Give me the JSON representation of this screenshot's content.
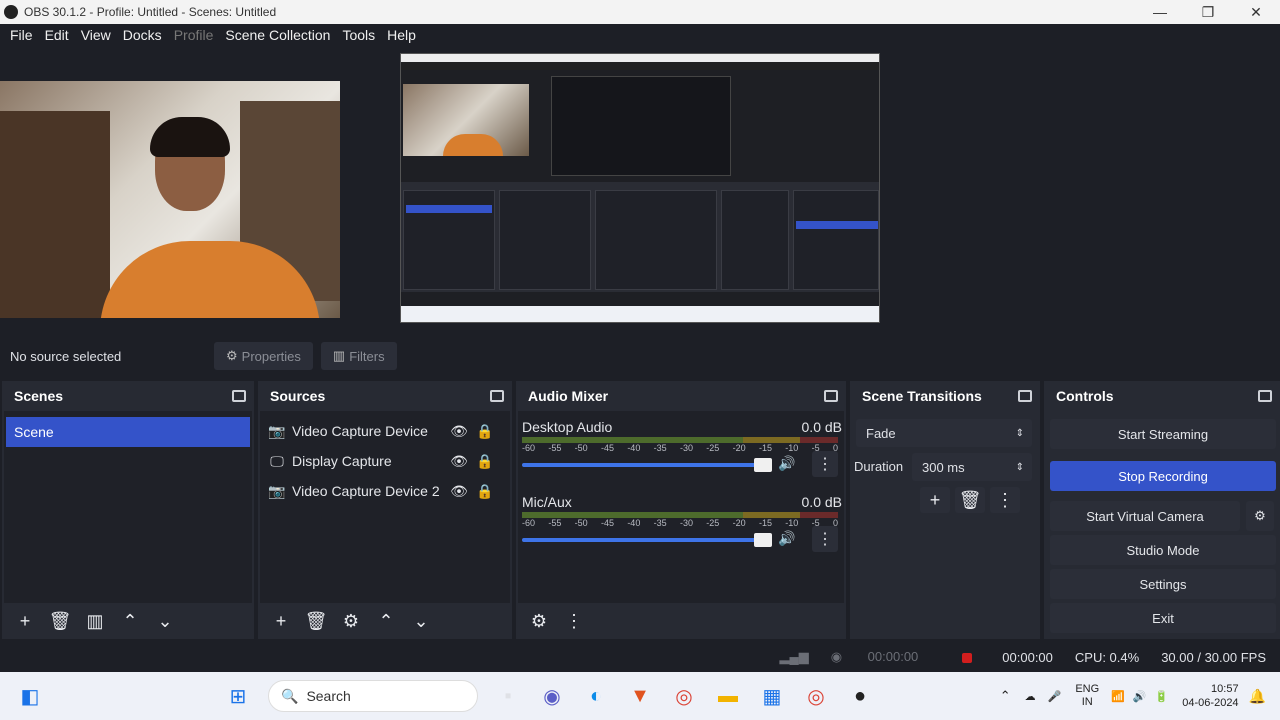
{
  "window": {
    "title": "OBS 30.1.2 - Profile: Untitled - Scenes: Untitled"
  },
  "menu": [
    "File",
    "Edit",
    "View",
    "Docks",
    "Profile",
    "Scene Collection",
    "Tools",
    "Help"
  ],
  "source_bar": {
    "no_source": "No source selected",
    "properties": "Properties",
    "filters": "Filters"
  },
  "scenes": {
    "title": "Scenes",
    "items": [
      "Scene"
    ]
  },
  "sources": {
    "title": "Sources",
    "items": [
      "Video Capture Device",
      "Display Capture",
      "Video Capture Device 2"
    ]
  },
  "mixer": {
    "title": "Audio Mixer",
    "channels": [
      {
        "name": "Desktop Audio",
        "level": "0.0 dB"
      },
      {
        "name": "Mic/Aux",
        "level": "0.0 dB"
      }
    ],
    "ticks": [
      "-60",
      "-55",
      "-50",
      "-45",
      "-40",
      "-35",
      "-30",
      "-25",
      "-20",
      "-15",
      "-10",
      "-5",
      "0"
    ]
  },
  "transitions": {
    "title": "Scene Transitions",
    "type": "Fade",
    "duration_label": "Duration",
    "duration": "300 ms"
  },
  "controls": {
    "title": "Controls",
    "buttons": [
      "Start Streaming",
      "Stop Recording",
      "Start Virtual Camera",
      "Studio Mode",
      "Settings",
      "Exit"
    ]
  },
  "status": {
    "stream_time": "00:00:00",
    "rec_time": "00:00:00",
    "cpu": "CPU: 0.4%",
    "fps": "30.00 / 30.00 FPS"
  },
  "taskbar": {
    "search": "Search",
    "lang1": "ENG",
    "lang2": "IN",
    "time": "10:57",
    "date": "04-06-2024"
  },
  "colors": {
    "accent": "#3453c9",
    "panel": "#272a33",
    "bg": "#1d1f26"
  }
}
